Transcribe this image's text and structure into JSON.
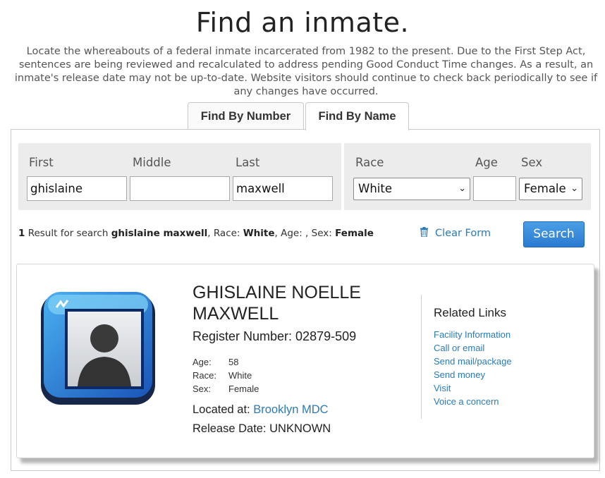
{
  "header": {
    "title": "Find an inmate.",
    "intro": "Locate the whereabouts of a federal inmate incarcerated from 1982 to the present. Due to the First Step Act, sentences are being reviewed and recalculated to address pending Good Conduct Time changes. As a result, an inmate's release date may not be up-to-date. Website visitors should continue to check back periodically to see if any changes have occurred."
  },
  "tabs": {
    "by_number": "Find By Number",
    "by_name": "Find By Name",
    "active": "by_name"
  },
  "form": {
    "first_label": "First",
    "first_value": "ghislaine",
    "middle_label": "Middle",
    "middle_value": "",
    "last_label": "Last",
    "last_value": "maxwell",
    "race_label": "Race",
    "race_value": "White",
    "age_label": "Age",
    "age_value": "",
    "sex_label": "Sex",
    "sex_value": "Female"
  },
  "results": {
    "count": "1",
    "text_a": " Result for search ",
    "query": "ghislaine maxwell",
    "text_b": ", Race: ",
    "race": "White",
    "text_c": ", Age: , Sex: ",
    "sex": "Female"
  },
  "actions": {
    "clear_label": "Clear Form",
    "search_label": "Search"
  },
  "inmate": {
    "name_line1": "GHISLAINE NOELLE",
    "name_line2": "MAXWELL",
    "register_number": "Register Number: 02879-509",
    "age_label": "Age:",
    "age": "58",
    "race_label": "Race:",
    "race": "White",
    "sex_label": "Sex:",
    "sex": "Female",
    "located_label": "Located at: ",
    "facility": "Brooklyn MDC",
    "release": "Release Date: UNKNOWN"
  },
  "related_links": {
    "title": "Related Links",
    "items": [
      "Facility Information",
      "Call or email",
      "Send mail/package",
      "Send money",
      "Visit",
      "Voice a concern"
    ]
  },
  "icons": {
    "avatar": "person-portrait-icon",
    "clear": "trash-icon",
    "select": "chevron-down-icon"
  },
  "colors": {
    "link": "#2a7ab8",
    "search_button": "#3a8fdc"
  }
}
